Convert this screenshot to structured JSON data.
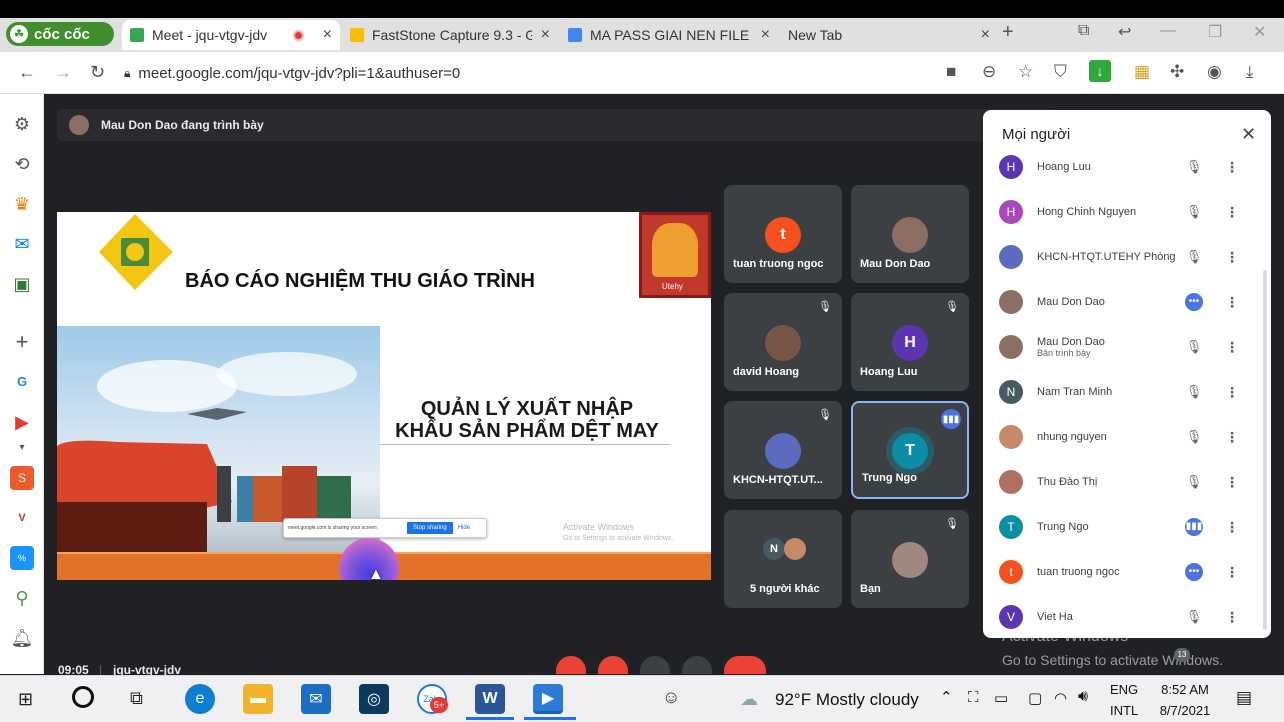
{
  "browser": {
    "brand_name": "cốc cốc",
    "tabs": [
      {
        "label": "Meet - jqu-vtgv-jdv",
        "favicon_color": "#34a853"
      },
      {
        "label": "FastStone Capture 9.3 - G",
        "favicon_color": "#fbbc04"
      },
      {
        "label": "MA PASS GIAI NEN FILE -",
        "favicon_color": "#4285f4"
      },
      {
        "label": "New Tab",
        "favicon_color": "#e0e0e0"
      }
    ],
    "url": "meet.google.com/jqu-vtgv-jdv?pli=1&authuser=0"
  },
  "meet": {
    "presenting_banner": "Mau Don Dao đang trình bày",
    "slide": {
      "title": "BÁO CÁO NGHIỆM THU GIÁO TRÌNH",
      "subtitle_line1": "QUẢN LÝ XUẤT NHẬP",
      "subtitle_line2": "KHẨU SẢN PHẨM DỆT MAY",
      "logo_text": "Utehy",
      "sharing_bar_text": "meet.google.com is sharing your screen.",
      "stop_sharing": "Stop sharing",
      "hide": "Hide",
      "activate_line1": "Activate Windows",
      "activate_line2": "Go to Settings to activate Windows."
    },
    "tiles": [
      {
        "name": "tuan truong ngoc",
        "initial": "t",
        "color": "#f4511e",
        "muted": false,
        "speaking": false
      },
      {
        "name": "Mau Don Dao",
        "initial": "",
        "color": "#8d6e63",
        "muted": false,
        "speaking": false
      },
      {
        "name": "david Hoang",
        "initial": "",
        "color": "#795548",
        "muted": true,
        "speaking": false
      },
      {
        "name": "Hoang Luu",
        "initial": "H",
        "color": "#5e35b1",
        "muted": true,
        "speaking": false
      },
      {
        "name": "KHCN-HTQT.UT...",
        "initial": "",
        "color": "#5c6bc0",
        "muted": true,
        "speaking": false
      },
      {
        "name": "Trung Ngo",
        "initial": "T",
        "color": "#0b8ea5",
        "muted": false,
        "speaking": true
      },
      {
        "name": "5 người khác",
        "initial": "N",
        "color": "#455a64",
        "muted": false,
        "speaking": false
      },
      {
        "name": "Bạn",
        "initial": "",
        "color": "#a1887f",
        "muted": true,
        "speaking": false
      }
    ],
    "people_panel": {
      "title": "Mọi người",
      "participants": [
        {
          "name": "Hoang Luu",
          "sub": "",
          "initial": "H",
          "color": "#5e35b1",
          "status": "muted"
        },
        {
          "name": "Hong Chinh Nguyen",
          "sub": "",
          "initial": "H",
          "color": "#ab47bc",
          "status": "muted"
        },
        {
          "name": "KHCN-HTQT.UTEHY Phòng",
          "sub": "",
          "initial": "",
          "color": "#5c6bc0",
          "status": "muted"
        },
        {
          "name": "Mau Don Dao",
          "sub": "",
          "initial": "",
          "color": "#8d6e63",
          "status": "more"
        },
        {
          "name": "Mau Don Dao",
          "sub": "Bản trình bày",
          "initial": "",
          "color": "#8d6e63",
          "status": "muted-off"
        },
        {
          "name": "Nam Tran Minh",
          "sub": "",
          "initial": "N",
          "color": "#455a64",
          "status": "muted"
        },
        {
          "name": "nhung nguyen",
          "sub": "",
          "initial": "",
          "color": "#c48a6a",
          "status": "muted"
        },
        {
          "name": "Thu Đào Thị",
          "sub": "",
          "initial": "",
          "color": "#b07060",
          "status": "muted"
        },
        {
          "name": "Trung Ngo",
          "sub": "",
          "initial": "T",
          "color": "#0b8ea5",
          "status": "speaking"
        },
        {
          "name": "tuan truong ngoc",
          "sub": "",
          "initial": "t",
          "color": "#f4511e",
          "status": "more"
        },
        {
          "name": "Viet Ha",
          "sub": "",
          "initial": "V",
          "color": "#5e35b1",
          "status": "muted"
        }
      ]
    },
    "bottom": {
      "time": "09:05",
      "meeting_code": "jqu-vtgv-jdv",
      "people_count": "13"
    },
    "activate_windows_line1": "Activate Windows",
    "activate_windows_line2": "Go to Settings to activate Windows."
  },
  "taskbar": {
    "zalo_badge": "5+",
    "weather": "92°F  Mostly cloudy",
    "lang1": "ENG",
    "lang2": "INTL",
    "time": "8:52 AM",
    "date": "8/7/2021"
  }
}
